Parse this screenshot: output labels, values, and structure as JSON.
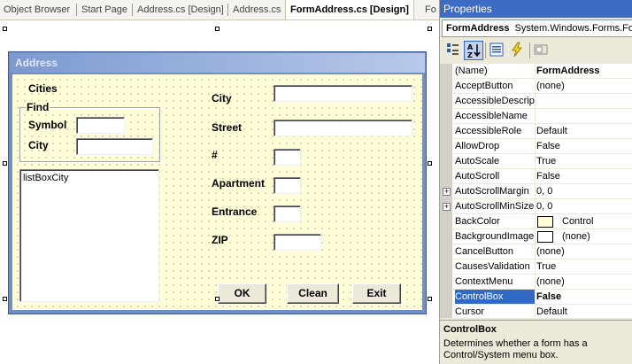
{
  "tabs": [
    {
      "label": "Object Browser"
    },
    {
      "label": "Start Page"
    },
    {
      "label": "Address.cs [Design]"
    },
    {
      "label": "Address.cs"
    },
    {
      "label": "FormAddress.cs [Design]"
    },
    {
      "label": "Fo"
    }
  ],
  "form": {
    "title": "Address",
    "cities_label": "Cities",
    "find_group": "Find",
    "symbol_label": "Symbol",
    "find_city_label": "City",
    "listbox_item": "listBoxCity",
    "city_label": "City",
    "street_label": "Street",
    "number_label": "#",
    "apartment_label": "Apartment",
    "entrance_label": "Entrance",
    "zip_label": "ZIP",
    "ok_button": "OK",
    "clean_button": "Clean",
    "exit_button": "Exit",
    "back_color": "#fffcd8"
  },
  "properties": {
    "title": "Properties",
    "object_name": "FormAddress",
    "object_type": "System.Windows.Forms.Fo",
    "rows": [
      {
        "name": "(Name)",
        "value": "FormAddress",
        "bold": true
      },
      {
        "name": "AcceptButton",
        "value": "(none)"
      },
      {
        "name": "AccessibleDescript",
        "value": ""
      },
      {
        "name": "AccessibleName",
        "value": ""
      },
      {
        "name": "AccessibleRole",
        "value": "Default"
      },
      {
        "name": "AllowDrop",
        "value": "False"
      },
      {
        "name": "AutoScale",
        "value": "True"
      },
      {
        "name": "AutoScroll",
        "value": "False"
      },
      {
        "name": "AutoScrollMargin",
        "value": "0, 0",
        "expandable": true
      },
      {
        "name": "AutoScrollMinSize",
        "value": "0, 0",
        "expandable": true
      },
      {
        "name": "BackColor",
        "value": "Control",
        "swatch": "#fffcd8"
      },
      {
        "name": "BackgroundImage",
        "value": "(none)",
        "swatch": "#ffffff"
      },
      {
        "name": "CancelButton",
        "value": "(none)"
      },
      {
        "name": "CausesValidation",
        "value": "True"
      },
      {
        "name": "ContextMenu",
        "value": "(none)"
      },
      {
        "name": "ControlBox",
        "value": "False",
        "selected": true
      },
      {
        "name": "Cursor",
        "value": "Default"
      }
    ],
    "description_title": "ControlBox",
    "description_text": "Determines whether a form has a Control/System menu box.",
    "accent_color": "#3d6cc4",
    "selection_color": "#316ac5"
  }
}
